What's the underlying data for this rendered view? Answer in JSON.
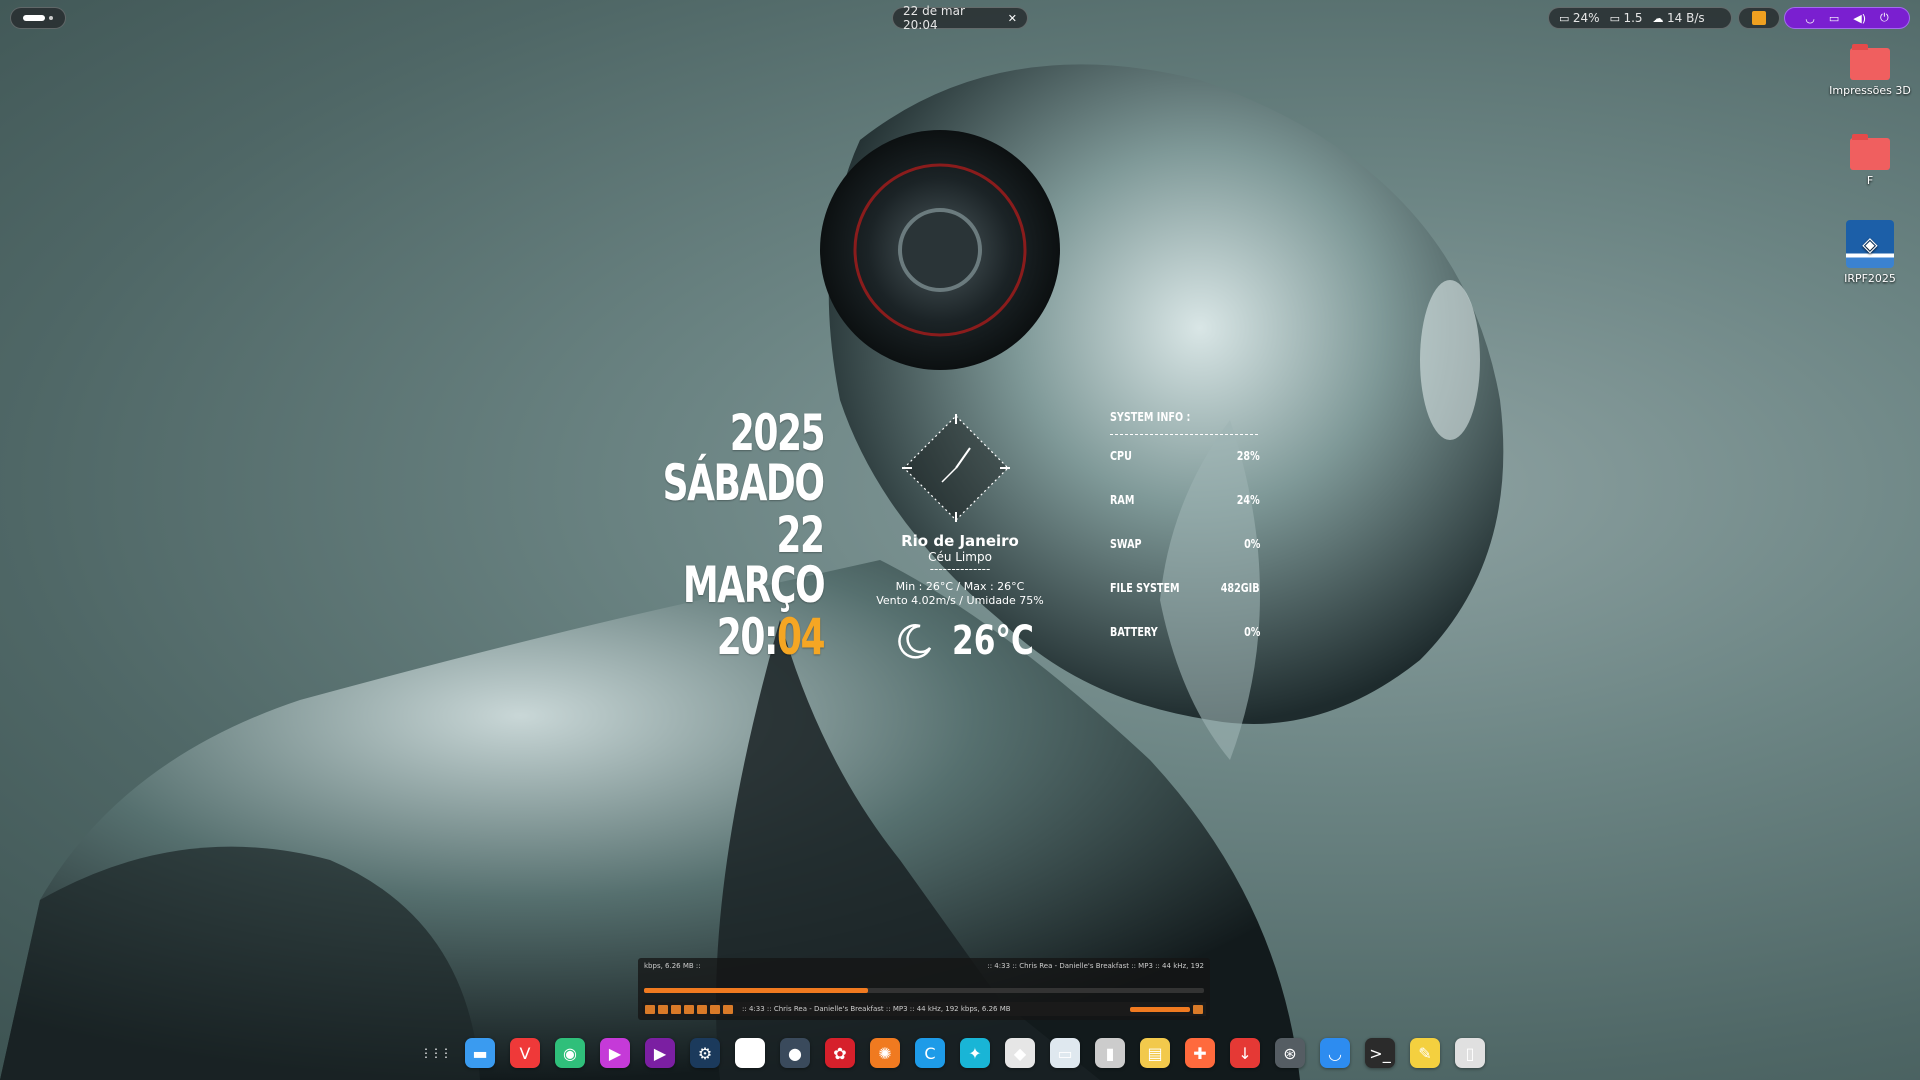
{
  "topbar": {
    "clock": "22 de mar  20:04",
    "cpu": "24%",
    "load": "1.5",
    "network": "14 B/s"
  },
  "desktop_icons": [
    {
      "label": "Impressões 3D",
      "icon": "folder-icon"
    },
    {
      "label": "F",
      "icon": "folder-icon"
    },
    {
      "label": "IRPF2025",
      "icon": "irpf-app-icon"
    }
  ],
  "date_widget": {
    "year": "2025",
    "weekday": "SÁBADO",
    "day": "22",
    "month": "MARÇO",
    "hour": "20:",
    "minute": "04",
    "accent": "#f5a623"
  },
  "weather": {
    "city": "Rio de Janeiro",
    "condition": "Céu Limpo",
    "separator": "--------------",
    "minmax": "Min : 26°C / Max : 26°C",
    "wind_humidity": "Vento 4.02m/s / Umidade 75%",
    "temperature": "26°C"
  },
  "sysinfo": {
    "title": "SYSTEM INFO :",
    "rows": [
      {
        "label": "CPU",
        "value": "28%"
      },
      {
        "label": "RAM",
        "value": "24%"
      },
      {
        "label": "SWAP",
        "value": "0%"
      },
      {
        "label": "FILE SYSTEM",
        "value": "482GIB"
      },
      {
        "label": "BATTERY",
        "value": "0%"
      }
    ]
  },
  "player": {
    "left_info": "kbps, 6.26 MB ::",
    "right_info": ":: 4:33 :: Chris Rea - Danielle's Breakfast :: MP3 :: 44 kHz, 192",
    "ticker": ":: 4:33 :: Chris Rea - Danielle's Breakfast :: MP3 :: 44 kHz, 192 kbps, 6.26 MB",
    "progress": 0.4
  },
  "dock": [
    {
      "name": "app-grid-icon",
      "bg": "transparent",
      "glyph": "⋮⋮⋮"
    },
    {
      "name": "files-icon",
      "bg": "#3a9bf0",
      "glyph": "▬"
    },
    {
      "name": "vivaldi-icon",
      "bg": "#ef3939",
      "glyph": "V"
    },
    {
      "name": "app-green-icon",
      "bg": "#2fbf7a",
      "glyph": "◉"
    },
    {
      "name": "media-app-icon",
      "bg": "#c53ad8",
      "glyph": "▶"
    },
    {
      "name": "play-app-icon",
      "bg": "#7b1fa2",
      "glyph": "▶"
    },
    {
      "name": "steam-icon",
      "bg": "#1b3a5c",
      "glyph": "⚙"
    },
    {
      "name": "app-orange-icon",
      "bg": "#ffffff",
      "glyph": "▥"
    },
    {
      "name": "app-blue-circle-icon",
      "bg": "#3a4a5c",
      "glyph": "●"
    },
    {
      "name": "game-app-icon",
      "bg": "#d6202b",
      "glyph": "✿"
    },
    {
      "name": "aperture-icon",
      "bg": "#f07a20",
      "glyph": "✺"
    },
    {
      "name": "cloud-app-icon",
      "bg": "#1e9be8",
      "glyph": "C"
    },
    {
      "name": "teal-app-icon",
      "bg": "#19b5d6",
      "glyph": "✦"
    },
    {
      "name": "android-icon",
      "bg": "#e6e6e6",
      "glyph": "◆"
    },
    {
      "name": "window-app-icon",
      "bg": "#dfe8ef",
      "glyph": "▭"
    },
    {
      "name": "usb-app-icon",
      "bg": "#cccccc",
      "glyph": "▮"
    },
    {
      "name": "archive-app-icon",
      "bg": "#f2c94c",
      "glyph": "▤"
    },
    {
      "name": "gamepad-icon",
      "bg": "#ff6a3d",
      "glyph": "✚"
    },
    {
      "name": "download-app-icon",
      "bg": "#e53935",
      "glyph": "↓"
    },
    {
      "name": "steering-app-icon",
      "bg": "#555d63",
      "glyph": "⊛"
    },
    {
      "name": "store-app-icon",
      "bg": "#2d8cf0",
      "glyph": "◡"
    },
    {
      "name": "terminal-icon",
      "bg": "#2b2b2b",
      "glyph": ">_"
    },
    {
      "name": "editor-app-icon",
      "bg": "#f4d03f",
      "glyph": "✎"
    },
    {
      "name": "trash-icon",
      "bg": "#e0e0e0",
      "glyph": "▯"
    }
  ]
}
